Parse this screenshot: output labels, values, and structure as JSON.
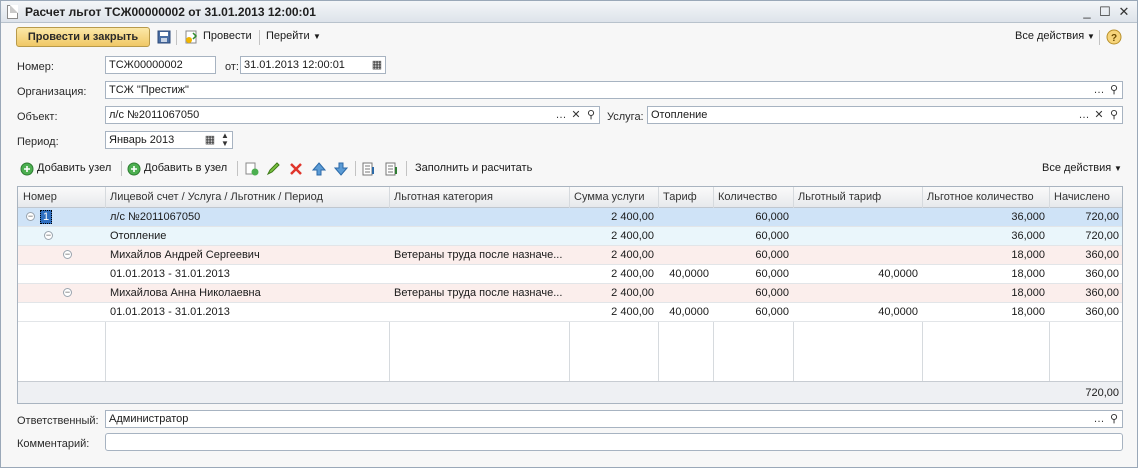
{
  "window": {
    "title": "Расчет льгот ТСЖ00000002 от 31.01.2013 12:00:01"
  },
  "toolbar": {
    "post_close": "Провести и закрыть",
    "post": "Провести",
    "goto": "Перейти",
    "all_actions": "Все действия"
  },
  "form": {
    "number_label": "Номер:",
    "number_value": "ТСЖ00000002",
    "from_label": "от:",
    "date_value": "31.01.2013 12:00:01",
    "org_label": "Организация:",
    "org_value": "ТСЖ \"Престиж\"",
    "object_label": "Объект:",
    "object_value": "л/с №2011067050",
    "service_label": "Услуга:",
    "service_value": "Отопление",
    "period_label": "Период:",
    "period_value": "Январь 2013"
  },
  "table_toolbar": {
    "add_node": "Добавить узел",
    "add_in_node": "Добавить в узел",
    "fill_calc": "Заполнить и расчитать",
    "all_actions": "Все действия"
  },
  "table": {
    "columns": [
      "Номер",
      "Лицевой счет / Услуга / Льготник / Период",
      "Льготная категория",
      "Сумма услуги",
      "Тариф",
      "Количество",
      "Льготный тариф",
      "Льготное количество",
      "Начислено"
    ],
    "rows": [
      {
        "num": "1",
        "name": "л/с №2011067050",
        "cat": "",
        "sum": "2 400,00",
        "tariff": "",
        "qty": "60,000",
        "ltariff": "",
        "lqty": "36,000",
        "accr": "720,00"
      },
      {
        "num": "",
        "name": "Отопление",
        "cat": "",
        "sum": "2 400,00",
        "tariff": "",
        "qty": "60,000",
        "ltariff": "",
        "lqty": "36,000",
        "accr": "720,00"
      },
      {
        "num": "",
        "name": "Михайлов Андрей Сергеевич",
        "cat": "Ветераны труда после назначе...",
        "sum": "2 400,00",
        "tariff": "",
        "qty": "60,000",
        "ltariff": "",
        "lqty": "18,000",
        "accr": "360,00"
      },
      {
        "num": "",
        "name": "01.01.2013 - 31.01.2013",
        "cat": "",
        "sum": "2 400,00",
        "tariff": "40,0000",
        "qty": "60,000",
        "ltariff": "40,0000",
        "lqty": "18,000",
        "accr": "360,00"
      },
      {
        "num": "",
        "name": "Михайлова Анна Николаевна",
        "cat": "Ветераны труда после назначе...",
        "sum": "2 400,00",
        "tariff": "",
        "qty": "60,000",
        "ltariff": "",
        "lqty": "18,000",
        "accr": "360,00"
      },
      {
        "num": "",
        "name": "01.01.2013 - 31.01.2013",
        "cat": "",
        "sum": "2 400,00",
        "tariff": "40,0000",
        "qty": "60,000",
        "ltariff": "40,0000",
        "lqty": "18,000",
        "accr": "360,00"
      }
    ],
    "total": "720,00"
  },
  "bottom": {
    "responsible_label": "Ответственный:",
    "responsible_value": "Администратор",
    "comment_label": "Комментарий:",
    "comment_value": ""
  },
  "colors": {
    "accent": "#f0c866",
    "row_selected": "#cfe3f7",
    "row_service": "#eaf6fb",
    "row_person": "#fbeeec"
  }
}
